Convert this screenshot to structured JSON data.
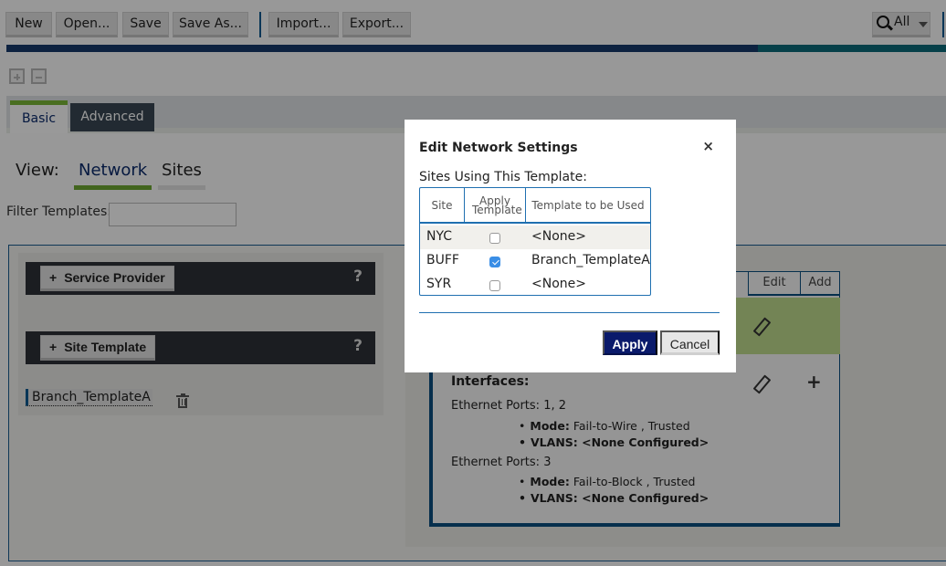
{
  "toolbar": {
    "buttons": [
      "New",
      "Open...",
      "Save",
      "Save As...",
      "Import...",
      "Export..."
    ],
    "search_scope": "All"
  },
  "progress": {
    "value_fraction": 0.8
  },
  "tabs": {
    "basic": "Basic",
    "advanced": "Advanced",
    "active": "Basic"
  },
  "view": {
    "label": "View:",
    "options": [
      "Network",
      "Sites"
    ],
    "active": "Network"
  },
  "filter": {
    "label": "Filter Templates:",
    "value": "",
    "placeholder": ""
  },
  "left_panel": {
    "service_provider_label": "Service Provider",
    "site_template_label": "Site Template",
    "help": "?",
    "templates": [
      "Branch_TemplateA"
    ]
  },
  "card": {
    "header_cols": [
      "Edit",
      "Add"
    ],
    "interfaces_title": "Interfaces:",
    "ports": [
      {
        "label": "Ethernet Ports: 1, 2",
        "mode_key": "Mode:",
        "mode_value": "Fail-to-Wire , Trusted",
        "vlans_key": "VLANS:",
        "vlans_value": "<None Configured>"
      },
      {
        "label": "Ethernet Ports: 3",
        "mode_key": "Mode:",
        "mode_value": "Fail-to-Block , Trusted",
        "vlans_key": "VLANS:",
        "vlans_value": "<None Configured>"
      }
    ]
  },
  "modal": {
    "title": "Edit Network Settings",
    "close": "×",
    "sites_label": "Sites Using This Template:",
    "columns": {
      "site": "Site",
      "apply": "Apply Template",
      "template": "Template to be Used"
    },
    "rows": [
      {
        "site": "NYC",
        "apply": false,
        "template": "<None>"
      },
      {
        "site": "BUFF",
        "apply": true,
        "template": "Branch_TemplateA"
      },
      {
        "site": "SYR",
        "apply": false,
        "template": "<None>"
      }
    ],
    "apply_label": "Apply",
    "cancel_label": "Cancel"
  }
}
